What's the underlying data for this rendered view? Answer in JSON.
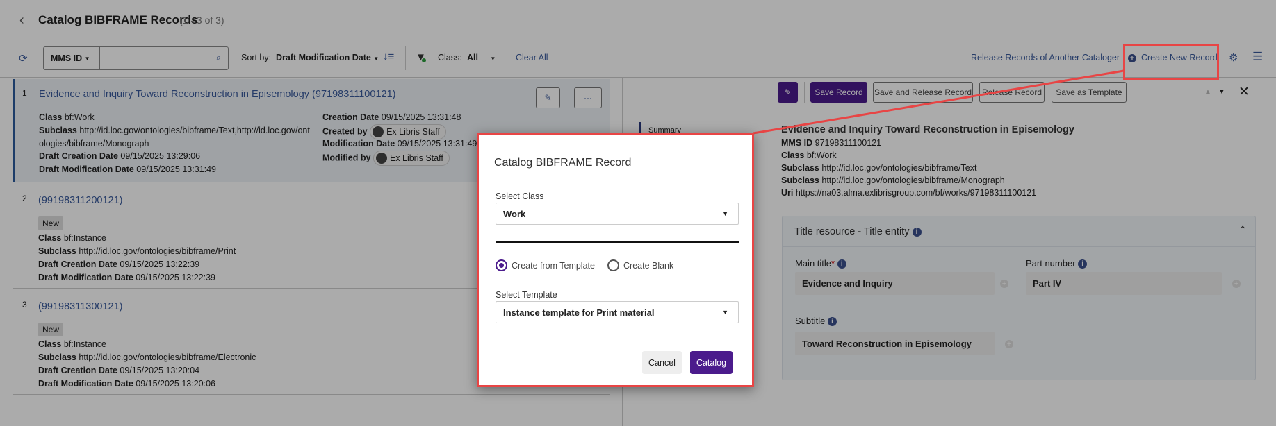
{
  "header": {
    "title": "Catalog BIBFRAME Records",
    "count": "(1 - 3 of 3)"
  },
  "toolbar": {
    "search_field": "MMS ID",
    "search_value": "",
    "sort_label": "Sort by:",
    "sort_value": "Draft Modification Date",
    "class_label": "Class:",
    "class_value": "All",
    "clear_all": "Clear All",
    "release_others": "Release Records of Another Cataloger",
    "create_new": "Create New Record"
  },
  "records": [
    {
      "num": "1",
      "title": "Evidence and Inquiry Toward Reconstruction in Episemology (97198311100121)",
      "class_label": "Class",
      "class": "bf:Work",
      "subclass_label": "Subclass",
      "subclass": "http://id.loc.gov/ontologies/bibframe/Text,http://id.loc.gov/ont",
      "subclass2": "ologies/bibframe/Monograph",
      "dcd_label": "Draft Creation Date",
      "dcd": "09/15/2025 13:29:06",
      "dmd_label": "Draft Modification Date",
      "dmd": "09/15/2025 13:31:49",
      "cd_label": "Creation Date",
      "cd": "09/15/2025 13:31:48",
      "cb_label": "Created by",
      "cb": "Ex Libris Staff",
      "md_label": "Modification Date",
      "md": "09/15/2025 13:31:49",
      "mb_label": "Modified by",
      "mb": "Ex Libris Staff"
    },
    {
      "num": "2",
      "title": "(99198311200121)",
      "badge": "New",
      "class_label": "Class",
      "class": "bf:Instance",
      "subclass_label": "Subclass",
      "subclass": "http://id.loc.gov/ontologies/bibframe/Print",
      "dcd_label": "Draft Creation Date",
      "dcd": "09/15/2025 13:22:39",
      "dmd_label": "Draft Modification Date",
      "dmd": "09/15/2025 13:22:39"
    },
    {
      "num": "3",
      "title": "(99198311300121)",
      "badge": "New",
      "class_label": "Class",
      "class": "bf:Instance",
      "subclass_label": "Subclass",
      "subclass": "http://id.loc.gov/ontologies/bibframe/Electronic",
      "dcd_label": "Draft Creation Date",
      "dcd": "09/15/2025 13:20:04",
      "dmd_label": "Draft Modification Date",
      "dmd": "09/15/2025 13:20:06"
    }
  ],
  "detail": {
    "buttons": {
      "save": "Save Record",
      "save_release": "Save and Release Record",
      "release": "Release Record",
      "save_template": "Save as Template"
    },
    "summary_tab": "Summary",
    "title": "Evidence and Inquiry Toward Reconstruction in Episemology",
    "lines": [
      {
        "label": "MMS ID",
        "value": "97198311100121"
      },
      {
        "label": "Class",
        "value": "bf:Work"
      },
      {
        "label": "Subclass",
        "value": "http://id.loc.gov/ontologies/bibframe/Text"
      },
      {
        "label": "Subclass",
        "value": "http://id.loc.gov/ontologies/bibframe/Monograph"
      },
      {
        "label": "Uri",
        "value": "https://na03.alma.exlibrisgroup.com/bf/works/97198311100121"
      }
    ],
    "section": {
      "title": "Title resource - Title entity",
      "main_title_label": "Main title",
      "required": "*",
      "main_title": "Evidence and Inquiry",
      "part_number_label": "Part number",
      "part_number": "Part IV",
      "subtitle_label": "Subtitle",
      "subtitle": "Toward Reconstruction in Episemology"
    }
  },
  "modal": {
    "title": "Catalog BIBFRAME Record",
    "class_label": "Select Class",
    "class_value": "Work",
    "radio_template": "Create from Template",
    "radio_blank": "Create Blank",
    "template_label": "Select Template",
    "template_value": "Instance template for Print material",
    "cancel": "Cancel",
    "catalog": "Catalog"
  },
  "colors": {
    "accent": "#4b1b8c",
    "link": "#3a5a9c",
    "highlight": "#e84545"
  }
}
